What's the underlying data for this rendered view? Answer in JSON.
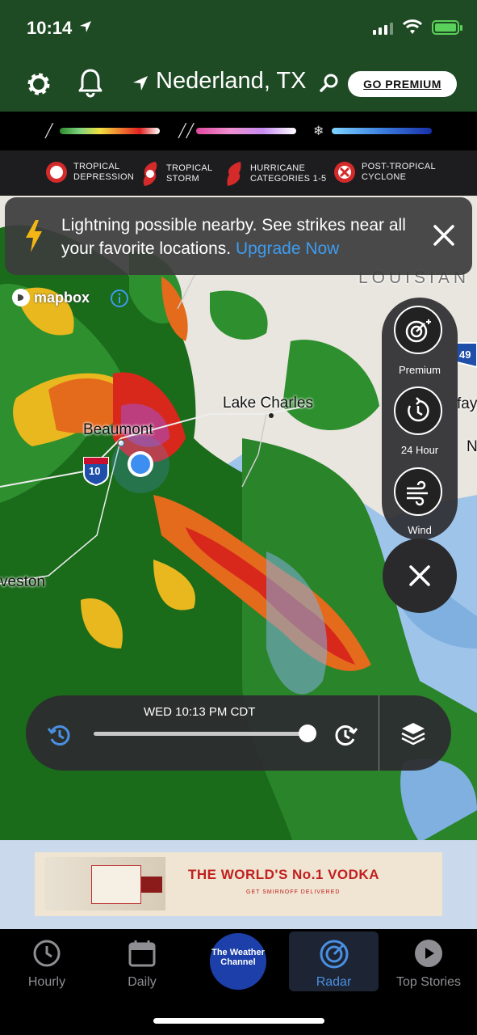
{
  "status": {
    "time": "10:14"
  },
  "header": {
    "location": "Nederland, TX",
    "premium_label": "GO PREMIUM"
  },
  "legend": {
    "storms": [
      {
        "label": "TROPICAL DEPRESSION",
        "line1": "TROPICAL",
        "line2": "DEPRESSION"
      },
      {
        "label": "TROPICAL STORM",
        "line1": "TROPICAL",
        "line2": "STORM"
      },
      {
        "label": "HURRICANE CATEGORIES 1-5",
        "line1": "HURRICANE",
        "line2": "CATEGORIES 1-5"
      },
      {
        "label": "POST-TROPICAL CYCLONE",
        "line1": "POST-TROPICAL",
        "line2": "CYCLONE"
      }
    ]
  },
  "banner": {
    "text": "Lightning possible nearby. See strikes near all your favorite locations.",
    "link": "Upgrade Now"
  },
  "map": {
    "attribution": "mapbox",
    "labels": {
      "beaumont": "Beaumont",
      "lake_charles": "Lake Charles",
      "louisiana": "LOUISIAN",
      "galveston": "veston",
      "fay": "fay",
      "n": "N",
      "i10": "10",
      "i49": "49"
    }
  },
  "side_controls": {
    "premium": "Premium",
    "history": "24 Hour",
    "wind": "Wind"
  },
  "timeline": {
    "timestamp": "WED 10:13 PM CDT"
  },
  "ad": {
    "headline": "THE WORLD'S No.1 VODKA",
    "subline": "GET SMIRNOFF DELIVERED",
    "brand": "SMIRNOFF"
  },
  "tabs": [
    {
      "label": "Hourly"
    },
    {
      "label": "Daily"
    },
    {
      "label": "The Weather Channel"
    },
    {
      "label": "Radar"
    },
    {
      "label": "Top Stories"
    }
  ],
  "colors": {
    "header_green": "#1e4a24",
    "accent_blue": "#4a90e2",
    "link_blue": "#3d9cf0",
    "ad_red": "#c21f1f"
  }
}
